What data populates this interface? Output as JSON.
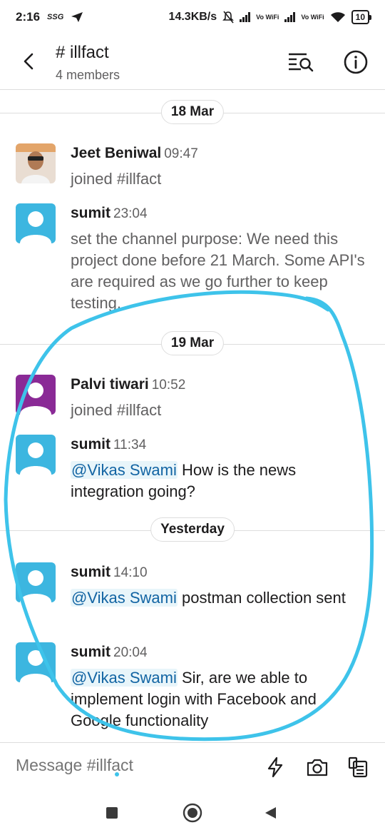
{
  "status_bar": {
    "time": "2:16",
    "carrier_icon": "SSG",
    "speed": "14.3KB/s",
    "vowifi_1": "Vo WiFi",
    "vowifi_2": "Vo WiFi",
    "battery": "10"
  },
  "header": {
    "title": "# illfact",
    "members": "4 members",
    "back_icon": "chevron-left-icon",
    "search_icon": "search-list-icon",
    "info_icon": "info-icon"
  },
  "messages": {
    "date_1": "18 Mar",
    "m1": {
      "author": "Jeet Beniwal",
      "time": "09:47",
      "text": "joined #illfact"
    },
    "m2": {
      "author": "sumit",
      "time": "23:04",
      "text": "set the channel purpose: We need this project done before 21 March. Some API's are required as we go further to keep testing."
    },
    "date_2": "19 Mar",
    "m3": {
      "author": "Palvi tiwari",
      "time": "10:52",
      "text": "joined #illfact"
    },
    "m4": {
      "author": "sumit",
      "time": "11:34",
      "mention": "@Vikas Swami",
      "text": " How is the news integration going?"
    },
    "date_3": "Yesterday",
    "m5": {
      "author": "sumit",
      "time": "14:10",
      "mention": "@Vikas Swami",
      "text": " postman collection sent"
    },
    "m6": {
      "author": "sumit",
      "time": "20:04",
      "mention": "@Vikas Swami",
      "text": " Sir, are we able to implement login with Facebook and Google functionality"
    }
  },
  "composer": {
    "placeholder": "Message #illfact",
    "shortcut_icon": "lightning-icon",
    "camera_icon": "camera-icon",
    "files_icon": "files-icon"
  },
  "nav": {
    "recents_icon": "square-icon",
    "home_icon": "circle-icon",
    "back_icon": "triangle-back-icon"
  },
  "colors": {
    "accent_link": "#1264a3",
    "avatar_blue": "#3cb6e0",
    "avatar_purple": "#8a2a96",
    "annotation": "#3ec3ea"
  }
}
